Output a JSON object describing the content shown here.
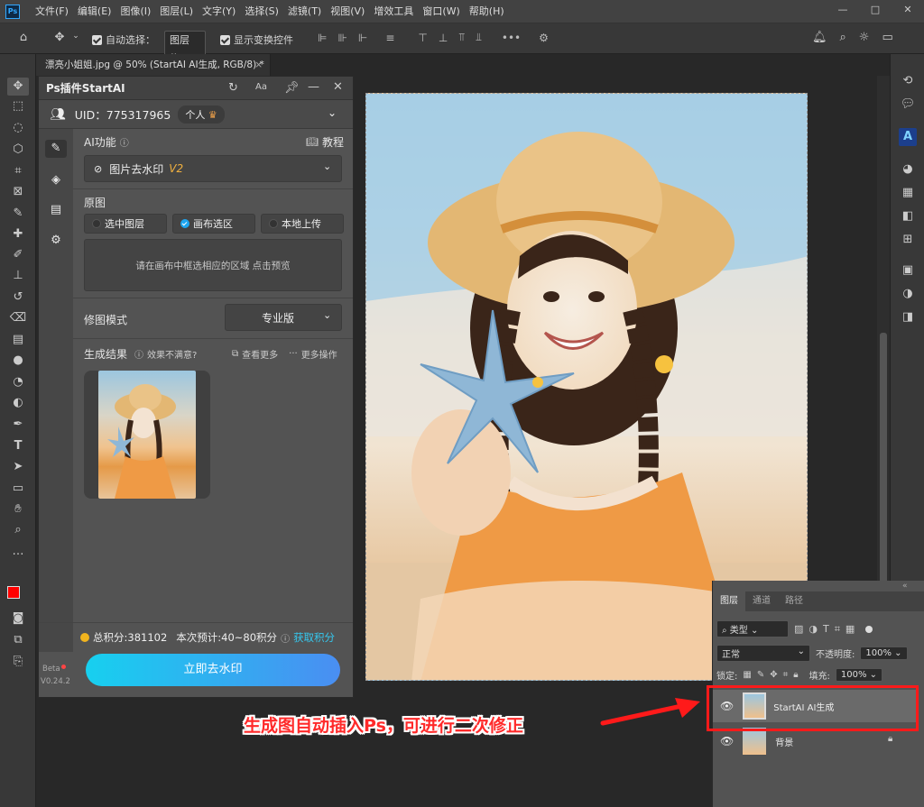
{
  "app": {
    "logo": "Ps"
  },
  "menubar": {
    "items": [
      "文件(F)",
      "编辑(E)",
      "图像(I)",
      "图层(L)",
      "文字(Y)",
      "选择(S)",
      "滤镜(T)",
      "视图(V)",
      "增效工具",
      "窗口(W)",
      "帮助(H)"
    ]
  },
  "window_controls": {
    "minimize": "—",
    "maximize": "□",
    "close": "✕"
  },
  "options_bar": {
    "auto_select_label": "自动选择：",
    "auto_select_value": "图层",
    "show_transform_label": "显示变换控件",
    "more": "•••"
  },
  "document": {
    "tab_title": "漂亮小姐姐.jpg @ 50% (StartAI AI生成, RGB/8) *"
  },
  "plugin": {
    "title": "Ps插件StartAI",
    "uid_label": "UID：775317965",
    "account_type": "个人",
    "ai_feature_label": "AI功能",
    "tutorial_label": "教程",
    "feature_selected": "图片去水印",
    "feature_version": "V2",
    "source_label": "原图",
    "source_options": [
      {
        "label": "选中图层",
        "selected": false
      },
      {
        "label": "画布选区",
        "selected": true
      },
      {
        "label": "本地上传",
        "selected": false
      }
    ],
    "drop_hint": "请在画布中框选相应的区域 点击预览",
    "mode_label": "修图模式",
    "mode_value": "专业版",
    "result_label": "生成结果",
    "unsatisfied_label": "效果不满意?",
    "view_more_label": "查看更多",
    "more_actions_label": "更多操作",
    "points_total": "总积分:381102",
    "points_estimate": "本次预计:40~80积分",
    "get_points": "获取积分",
    "action_button": "立即去水印",
    "version_badge": "Beta",
    "version": "V0.24.2"
  },
  "layers_panel": {
    "tabs": [
      "图层",
      "通道",
      "路径"
    ],
    "filter_label": "类型",
    "blend_mode": "正常",
    "opacity_label": "不透明度:",
    "opacity_value": "100%",
    "lock_label": "锁定:",
    "fill_label": "填充:",
    "fill_value": "100%",
    "layers": [
      {
        "name": "StartAI AI生成",
        "visible": true,
        "selected": true,
        "locked": false
      },
      {
        "name": "背景",
        "visible": true,
        "selected": false,
        "locked": true
      }
    ]
  },
  "annotation": {
    "caption": "生成图自动插入Ps，可进行二次修正",
    "color": "#ff2a2a"
  },
  "colors": {
    "accent": "#1ea6f0",
    "foreground": "#ff0000",
    "background": "#ffffff",
    "button_gradient_start": "#17d0ef",
    "button_gradient_end": "#4a8ef2"
  }
}
